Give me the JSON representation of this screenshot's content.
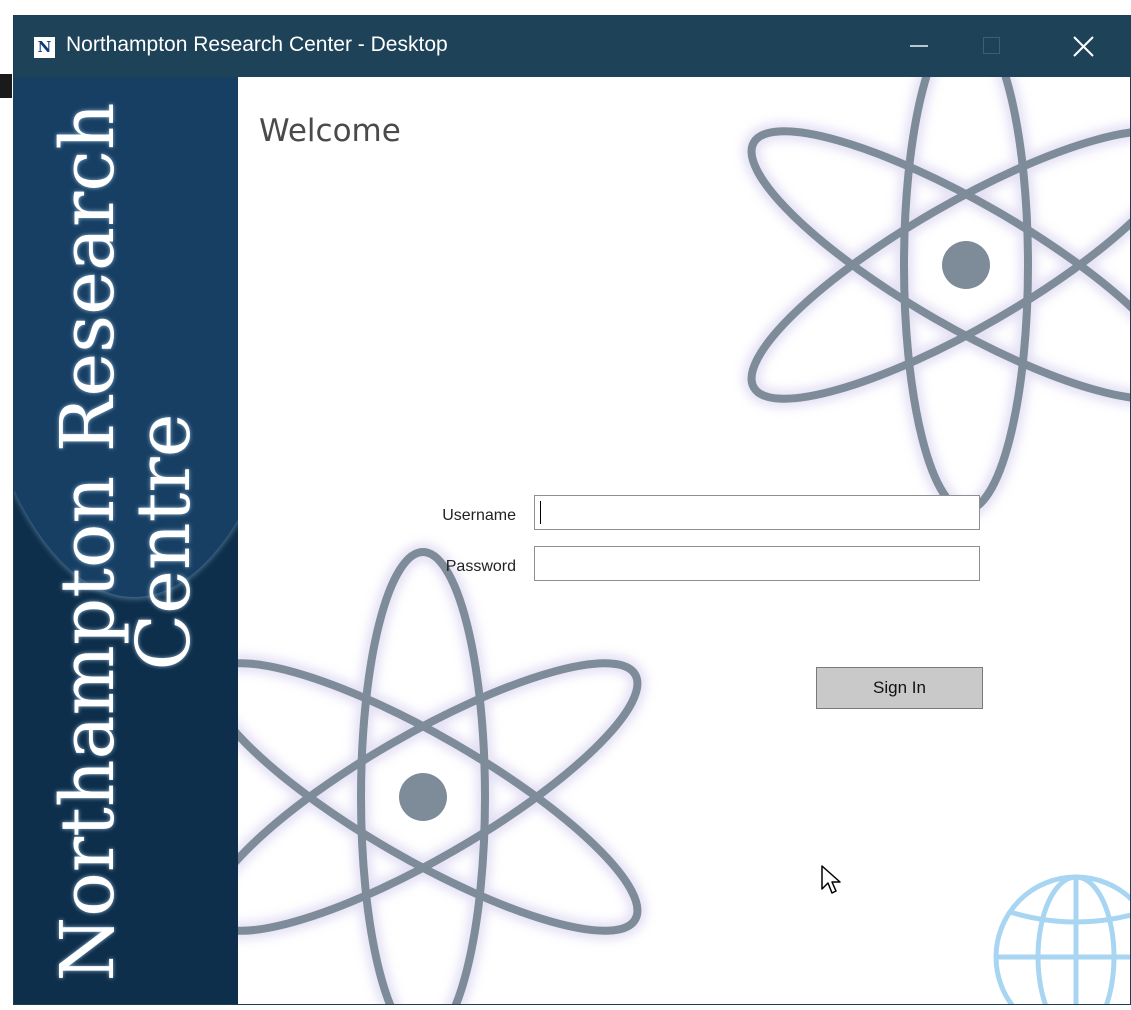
{
  "window": {
    "title": "Northampton Research Center - Desktop",
    "icon_letter": "N",
    "controls": {
      "minimize": "minimize-icon",
      "maximize": "maximize-icon",
      "close": "close-icon"
    }
  },
  "sidebar": {
    "line1": "Northampton Research",
    "line2": "Centre"
  },
  "main": {
    "heading": "Welcome",
    "username_label": "Username",
    "username_value": "",
    "password_label": "Password",
    "password_value": "",
    "sign_in_label": "Sign In"
  },
  "colors": {
    "titlebar": "#1e4258",
    "sidebar": "#0e2f4b",
    "atom": "#7d8c98",
    "button": "#c9c9c9"
  }
}
